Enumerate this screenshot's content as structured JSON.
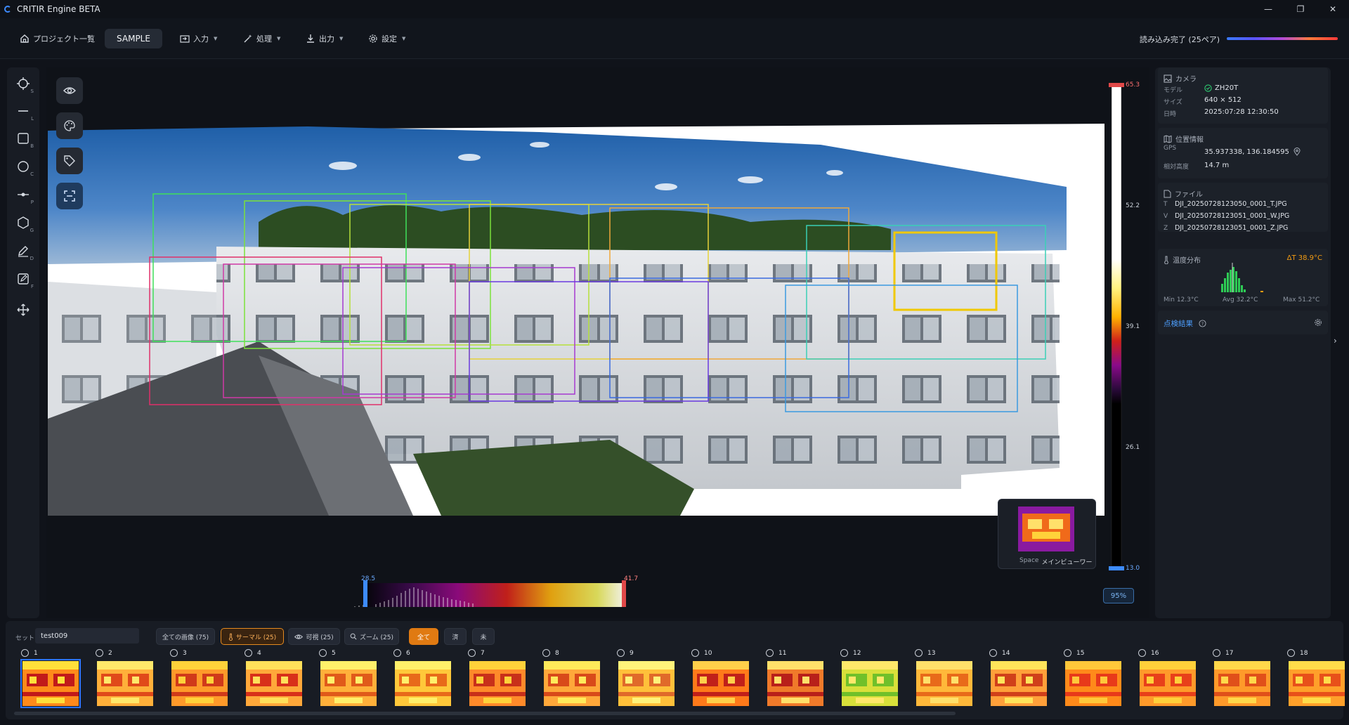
{
  "app": {
    "title": "CRITIR Engine BETA"
  },
  "window": {
    "minimize": "—",
    "restore": "❐",
    "close": "✕"
  },
  "menu": {
    "home": "プロジェクト一覧",
    "project_tab": "SAMPLE",
    "input": "入力",
    "process": "処理",
    "output": "出力",
    "settings": "設定",
    "load_status": "読み込み完了 (25ペア)"
  },
  "tools": [
    {
      "key": "S",
      "icon": "select-crosshair-icon"
    },
    {
      "key": "L",
      "icon": "line-icon"
    },
    {
      "key": "B",
      "icon": "box-icon"
    },
    {
      "key": "C",
      "icon": "circle-icon"
    },
    {
      "key": "P",
      "icon": "point-icon"
    },
    {
      "key": "G",
      "icon": "polygon-icon"
    },
    {
      "key": "D",
      "icon": "draw-icon"
    },
    {
      "key": "F",
      "icon": "edit-icon"
    },
    {
      "key": "",
      "icon": "move-icon"
    }
  ],
  "colorbar": {
    "max": "65.3",
    "t1": "52.2",
    "t2": "39.1",
    "t3": "26.1",
    "min": "13.0"
  },
  "zoom": "95%",
  "range_slider": {
    "low": "28.5",
    "high": "41.7"
  },
  "minimap": {
    "key": "Space",
    "label": "メインビューワー"
  },
  "camera": {
    "title": "カメラ",
    "model_label": "モデル",
    "model": "ZH20T",
    "size_label": "サイズ",
    "size": "640 × 512",
    "date_label": "日時",
    "date": "2025:07:28 12:30:50"
  },
  "location": {
    "title": "位置情報",
    "gps_label": "GPS",
    "gps": "35.937338, 136.184595",
    "alt_label": "相対高度",
    "alt": "14.7 m"
  },
  "files": {
    "title": "ファイル",
    "t_key": "T",
    "t": "DJI_20250728123050_0001_T.JPG",
    "v_key": "V",
    "v": "DJI_20250728123051_0001_W.JPG",
    "z_key": "Z",
    "z": "DJI_20250728123051_0001_Z.JPG"
  },
  "temperature": {
    "title": "温度分布",
    "delta": "ΔT 38.9°C",
    "min": "Min 12.3°C",
    "avg": "Avg 32.2°C",
    "max": "Max 51.2°C"
  },
  "inspection": {
    "title": "点検結果"
  },
  "set": {
    "label": "セット:",
    "value": "test009"
  },
  "filters": {
    "all_images": "全ての画像 (75)",
    "thermal": "サーマル (25)",
    "visible": "可視 (25)",
    "zoom": "ズーム (25)",
    "all": "全て",
    "done": "済",
    "todo": "未"
  },
  "thumbnails": [
    "1",
    "2",
    "3",
    "4",
    "5",
    "6",
    "7",
    "8",
    "9",
    "10",
    "11",
    "12",
    "13",
    "14",
    "15",
    "16",
    "17",
    "18"
  ]
}
